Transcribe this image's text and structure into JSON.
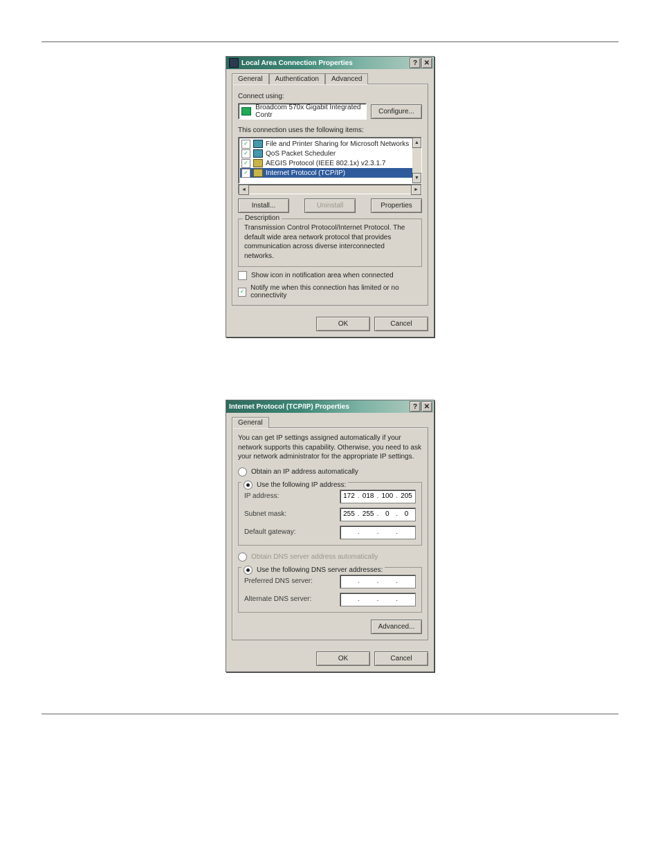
{
  "dialog1": {
    "title": "Local Area Connection Properties",
    "tabs": [
      "General",
      "Authentication",
      "Advanced"
    ],
    "connect_using_label": "Connect using:",
    "adapter_name": "Broadcom 570x Gigabit Integrated Contr",
    "configure_btn": "Configure...",
    "items_label": "This connection uses the following items:",
    "items": [
      {
        "checked": true,
        "label": "File and Printer Sharing for Microsoft Networks",
        "selected": false,
        "icon": "network"
      },
      {
        "checked": true,
        "label": "QoS Packet Scheduler",
        "selected": false,
        "icon": "network"
      },
      {
        "checked": true,
        "label": "AEGIS Protocol (IEEE 802.1x) v2.3.1.7",
        "selected": false,
        "icon": "yellow"
      },
      {
        "checked": true,
        "label": "Internet Protocol (TCP/IP)",
        "selected": true,
        "icon": "yellow"
      }
    ],
    "install_btn": "Install...",
    "uninstall_btn": "Uninstall",
    "properties_btn": "Properties",
    "description_legend": "Description",
    "description_text": "Transmission Control Protocol/Internet Protocol. The default wide area network protocol that provides communication across diverse interconnected networks.",
    "show_icon_checked": false,
    "show_icon_label": "Show icon in notification area when connected",
    "notify_checked": true,
    "notify_label": "Notify me when this connection has limited or no connectivity",
    "ok_btn": "OK",
    "cancel_btn": "Cancel"
  },
  "dialog2": {
    "title": "Internet Protocol (TCP/IP) Properties",
    "tabs": [
      "General"
    ],
    "intro_text": "You can get IP settings assigned automatically if your network supports this capability. Otherwise, you need to ask your network administrator for the appropriate IP settings.",
    "radio_auto_ip": "Obtain an IP address automatically",
    "radio_manual_ip": "Use the following IP address:",
    "ip_selected": "manual",
    "ip_label": "IP address:",
    "ip_value": [
      "172",
      "018",
      "100",
      "205"
    ],
    "subnet_label": "Subnet mask:",
    "subnet_value": [
      "255",
      "255",
      "0",
      "0"
    ],
    "gateway_label": "Default gateway:",
    "gateway_value": [
      "",
      "",
      "",
      ""
    ],
    "radio_auto_dns": "Obtain DNS server address automatically",
    "radio_manual_dns": "Use the following DNS server addresses:",
    "dns_selected": "manual",
    "pref_dns_label": "Preferred DNS server:",
    "pref_dns_value": [
      "",
      "",
      "",
      ""
    ],
    "alt_dns_label": "Alternate DNS server:",
    "alt_dns_value": [
      "",
      "",
      "",
      ""
    ],
    "advanced_btn": "Advanced...",
    "ok_btn": "OK",
    "cancel_btn": "Cancel"
  }
}
